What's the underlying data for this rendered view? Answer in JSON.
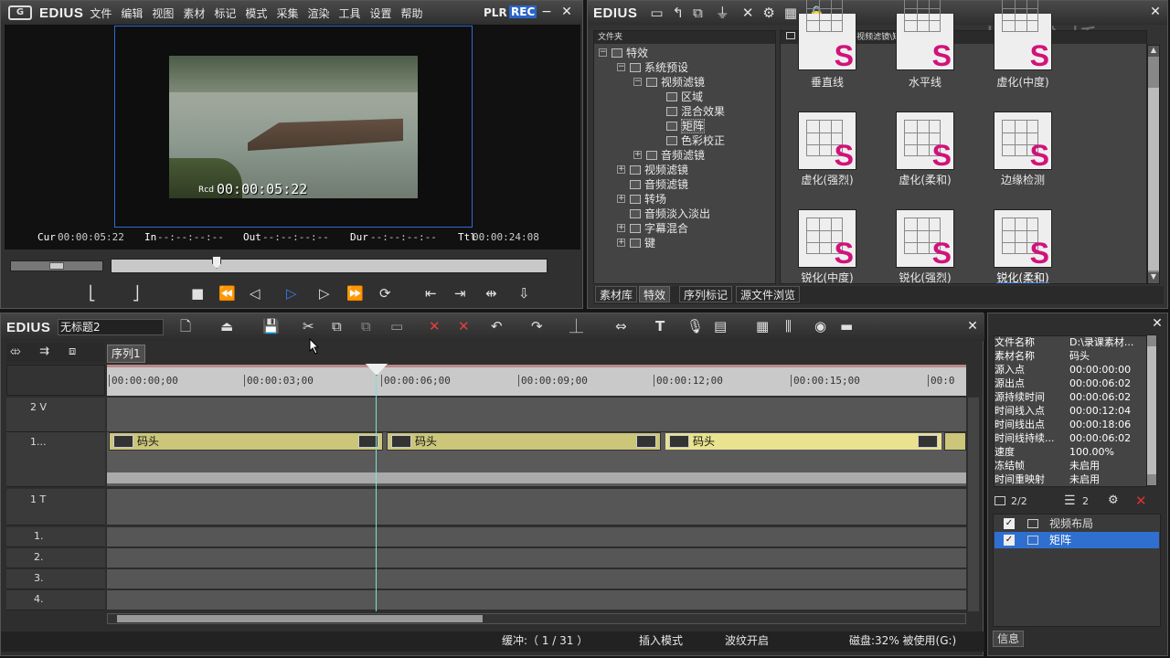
{
  "player": {
    "logo": "EDIUS",
    "menu": [
      "文件",
      "编辑",
      "视图",
      "素材",
      "标记",
      "模式",
      "采集",
      "渲染",
      "工具",
      "设置",
      "帮助"
    ],
    "plr": "PLR",
    "rec": "REC",
    "overlay_rcd": "Rcd",
    "overlay_tc": "00:00:05:22",
    "cur_label": "Cur",
    "cur_value": "00:00:05:22",
    "in_label": "In",
    "in_value": "--:--:--:--",
    "out_label": "Out",
    "out_value": "--:--:--:--",
    "dur_label": "Dur",
    "dur_value": "--:--:--:--",
    "ttl_label": "Ttl",
    "ttl_value": "00:00:24:08"
  },
  "effects": {
    "title": "EDIUS",
    "folder_header": "文件夹",
    "path": "\\特效\\系统预设\\视频滤镜\\矩阵\\",
    "watermark": "中新金桥",
    "tree": [
      {
        "label": "特效"
      },
      {
        "label": "系统预设"
      },
      {
        "label": "视频滤镜"
      },
      {
        "label": "区域"
      },
      {
        "label": "混合效果"
      },
      {
        "label": "矩阵"
      },
      {
        "label": "色彩校正"
      },
      {
        "label": "音频滤镜"
      },
      {
        "label": "视频滤镜"
      },
      {
        "label": "音频滤镜"
      },
      {
        "label": "转场"
      },
      {
        "label": "音频淡入淡出"
      },
      {
        "label": "字幕混合"
      },
      {
        "label": "键"
      }
    ],
    "items": [
      {
        "label": "垂直线"
      },
      {
        "label": "水平线"
      },
      {
        "label": "虚化(中度)"
      },
      {
        "label": "虚化(强烈)"
      },
      {
        "label": "虚化(柔和)"
      },
      {
        "label": "边缘检测"
      },
      {
        "label": "锐化(中度)"
      },
      {
        "label": "锐化(强烈)"
      },
      {
        "label": "锐化(柔和)"
      }
    ],
    "tabs": [
      "素材库",
      "特效",
      "序列标记",
      "源文件浏览"
    ]
  },
  "timeline": {
    "logo": "EDIUS",
    "project_name": "无标题2",
    "sequence_tab": "序列1",
    "ruler": [
      "00:00:00;00",
      "00:00:03;00",
      "00:00:06;00",
      "00:00:09;00",
      "00:00:12;00",
      "00:00:15;00",
      "00:0"
    ],
    "tracks": {
      "v2": "2 V",
      "v1": "1...",
      "t1": "1 T",
      "a1": "1.",
      "a2": "2.",
      "a3": "3.",
      "a4": "4."
    },
    "clips": [
      "码头",
      "码头",
      "码头"
    ]
  },
  "info": {
    "rows": [
      {
        "k": "文件名称",
        "v": "D:\\录课素材..."
      },
      {
        "k": "素材名称",
        "v": "码头"
      },
      {
        "k": "源入点",
        "v": "00:00:00:00"
      },
      {
        "k": "源出点",
        "v": "00:00:06:02"
      },
      {
        "k": "源持续时间",
        "v": "00:00:06:02"
      },
      {
        "k": "时间线入点",
        "v": "00:00:12:04"
      },
      {
        "k": "时间线出点",
        "v": "00:00:18:06"
      },
      {
        "k": "时间线持续...",
        "v": "00:00:06:02"
      },
      {
        "k": "速度",
        "v": "100.00%"
      },
      {
        "k": "冻结帧",
        "v": "未启用"
      },
      {
        "k": "时间重映射",
        "v": "未启用"
      }
    ],
    "count_a": "2/2",
    "count_b": "2",
    "effects_list": [
      "视频布局",
      "矩阵"
    ],
    "tab": "信息"
  },
  "status": {
    "buffer": "缓冲:（ 1 / 31 ）",
    "insert_mode": "插入模式",
    "ripple": "波纹开启",
    "disk": "磁盘:32% 被使用(G:)"
  }
}
